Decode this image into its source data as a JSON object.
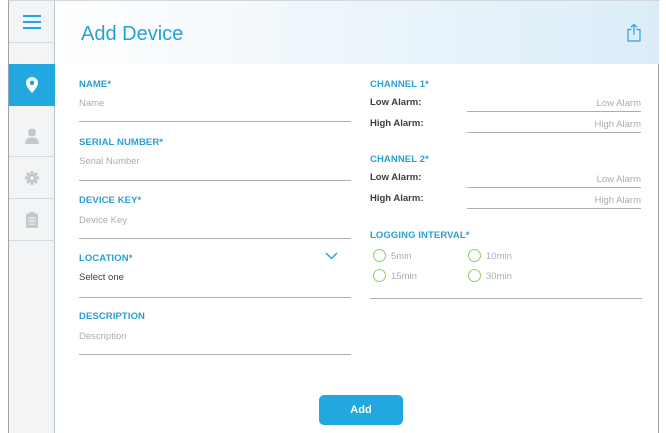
{
  "header": {
    "title": "Add Device"
  },
  "left_form": {
    "name": {
      "label": "NAME*",
      "placeholder": "Name"
    },
    "serial": {
      "label": "SERIAL NUMBER*",
      "placeholder": "Serial Number"
    },
    "device_key": {
      "label": "DEVICE KEY*",
      "placeholder": "Device Key"
    },
    "location": {
      "label": "LOCATION*",
      "value": "Select one"
    },
    "description": {
      "label": "DESCRIPTION",
      "placeholder": "Description"
    }
  },
  "channel1": {
    "label": "CHANNEL 1*",
    "low_label": "Low Alarm:",
    "low_placeholder": "Low Alarm",
    "high_label": "High Alarm:",
    "high_placeholder": "High Alarm"
  },
  "channel2": {
    "label": "CHANNEL 2*",
    "low_label": "Low Alarm:",
    "low_placeholder": "Low Alarm",
    "high_label": "High Alarm:",
    "high_placeholder": "High Alarm"
  },
  "logging": {
    "label": "LOGGING INTERVAL*",
    "options": [
      "5min",
      "10min",
      "15min",
      "30min"
    ]
  },
  "actions": {
    "add_label": "Add"
  },
  "colors": {
    "accent": "#22a7df",
    "radio": "#8ccf62"
  }
}
